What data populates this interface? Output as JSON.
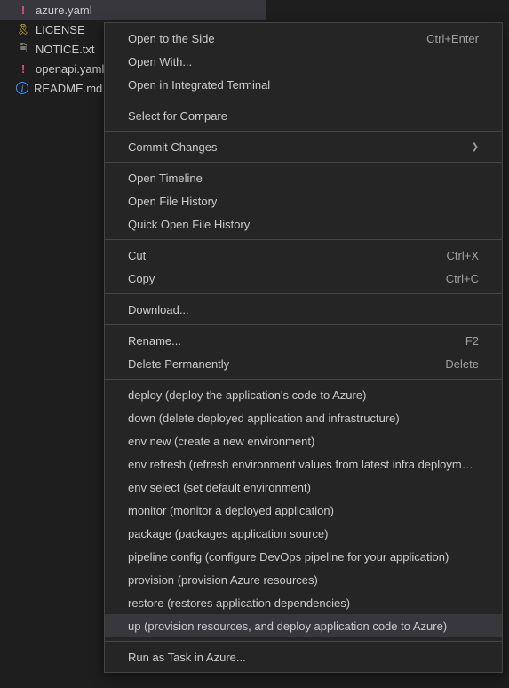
{
  "fileTree": {
    "items": [
      {
        "icon": "yaml",
        "label": "azure.yaml",
        "selected": true
      },
      {
        "icon": "license",
        "label": "LICENSE",
        "selected": false
      },
      {
        "icon": "txt",
        "label": "NOTICE.txt",
        "selected": false
      },
      {
        "icon": "yaml",
        "label": "openapi.yaml",
        "selected": false
      },
      {
        "icon": "info",
        "label": "README.md",
        "selected": false
      }
    ]
  },
  "contextMenu": {
    "groups": [
      [
        {
          "label": "Open to the Side",
          "shortcut": "Ctrl+Enter",
          "highlighted": false
        },
        {
          "label": "Open With...",
          "shortcut": "",
          "highlighted": false
        },
        {
          "label": "Open in Integrated Terminal",
          "shortcut": "",
          "highlighted": false
        }
      ],
      [
        {
          "label": "Select for Compare",
          "shortcut": "",
          "highlighted": false
        }
      ],
      [
        {
          "label": "Commit Changes",
          "shortcut": "",
          "submenu": true,
          "highlighted": false
        }
      ],
      [
        {
          "label": "Open Timeline",
          "shortcut": "",
          "highlighted": false
        },
        {
          "label": "Open File History",
          "shortcut": "",
          "highlighted": false
        },
        {
          "label": "Quick Open File History",
          "shortcut": "",
          "highlighted": false
        }
      ],
      [
        {
          "label": "Cut",
          "shortcut": "Ctrl+X",
          "highlighted": false
        },
        {
          "label": "Copy",
          "shortcut": "Ctrl+C",
          "highlighted": false
        }
      ],
      [
        {
          "label": "Download...",
          "shortcut": "",
          "highlighted": false
        }
      ],
      [
        {
          "label": "Rename...",
          "shortcut": "F2",
          "highlighted": false
        },
        {
          "label": "Delete Permanently",
          "shortcut": "Delete",
          "highlighted": false
        }
      ],
      [
        {
          "label": "deploy (deploy the application's code to Azure)",
          "shortcut": "",
          "highlighted": false
        },
        {
          "label": "down (delete deployed application and infrastructure)",
          "shortcut": "",
          "highlighted": false
        },
        {
          "label": "env new (create a new environment)",
          "shortcut": "",
          "highlighted": false
        },
        {
          "label": "env refresh (refresh environment values from latest infra deployment)",
          "shortcut": "",
          "highlighted": false
        },
        {
          "label": "env select (set default environment)",
          "shortcut": "",
          "highlighted": false
        },
        {
          "label": "monitor (monitor a deployed application)",
          "shortcut": "",
          "highlighted": false
        },
        {
          "label": "package (packages application source)",
          "shortcut": "",
          "highlighted": false
        },
        {
          "label": "pipeline config (configure DevOps pipeline for your application)",
          "shortcut": "",
          "highlighted": false
        },
        {
          "label": "provision (provision Azure resources)",
          "shortcut": "",
          "highlighted": false
        },
        {
          "label": "restore (restores application dependencies)",
          "shortcut": "",
          "highlighted": false
        },
        {
          "label": "up (provision resources, and deploy application code to Azure)",
          "shortcut": "",
          "highlighted": true
        }
      ],
      [
        {
          "label": "Run as Task in Azure...",
          "shortcut": "",
          "highlighted": false
        }
      ]
    ]
  },
  "icons": {
    "yaml": "!",
    "license": "🎗",
    "txt": "🗎",
    "info": "i"
  }
}
